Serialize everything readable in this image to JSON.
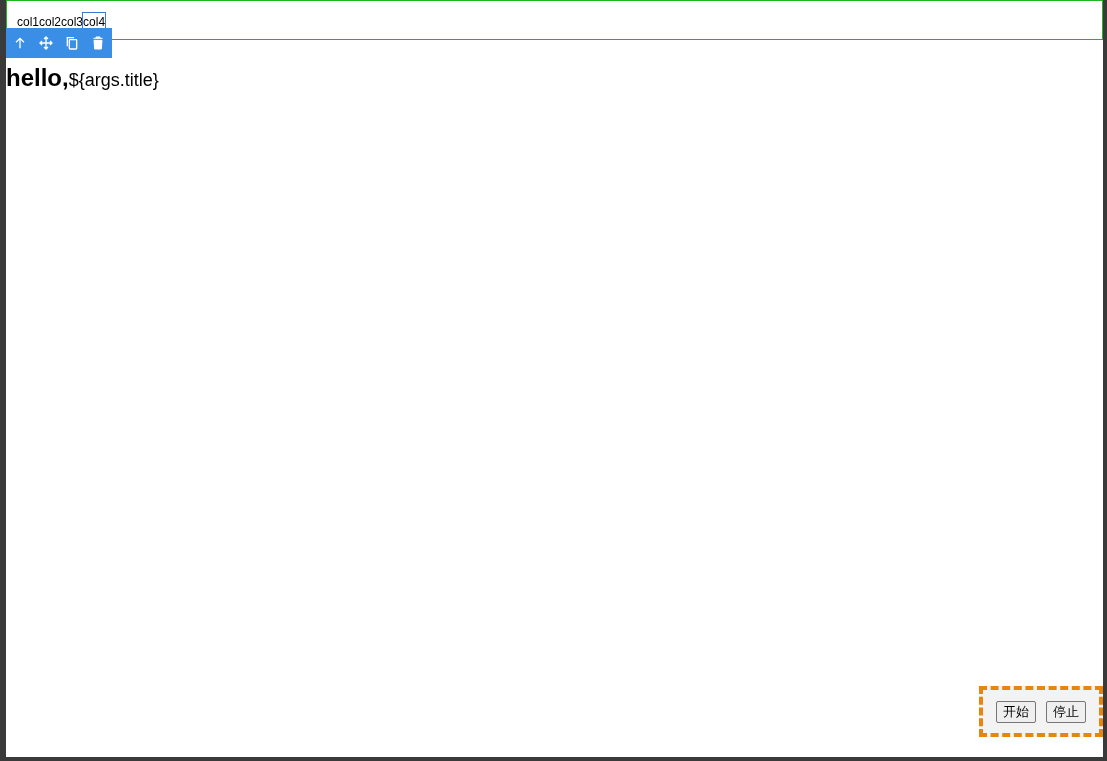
{
  "row": {
    "columns": [
      {
        "label": "col1",
        "selected": false
      },
      {
        "label": "col2",
        "selected": false
      },
      {
        "label": "col3",
        "selected": false
      },
      {
        "label": "col4",
        "selected": true
      }
    ],
    "toolbar": [
      {
        "kind": "up"
      },
      {
        "kind": "move"
      },
      {
        "kind": "copy"
      },
      {
        "kind": "delete"
      }
    ]
  },
  "heading": {
    "bold_text": "hello,",
    "text": "${args.title}"
  },
  "controls": [
    "开始",
    "停止"
  ]
}
